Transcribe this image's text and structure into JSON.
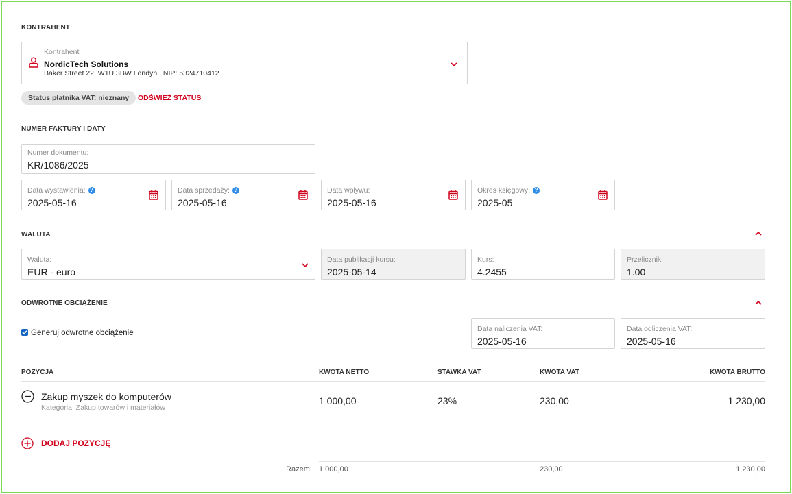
{
  "sections": {
    "contractor": "KONTRAHENT",
    "invoice_dates": "NUMER FAKTURY I DATY",
    "currency": "WALUTA",
    "reverse_charge": "ODWROTNE OBCIĄŻENIE"
  },
  "contractor": {
    "label": "Kontrahent",
    "name": "NordicTech Solutions",
    "address": "Baker Street 22, W1U 3BW Londyn . NIP: 5324710412",
    "vat_status": "Status płatnika VAT: nieznany",
    "refresh_status": "ODŚWIEŻ STATUS"
  },
  "document": {
    "number_label": "Numer dokumentu:",
    "number_value": "KR/1086/2025",
    "issue_label": "Data wystawienia:",
    "issue_value": "2025-05-16",
    "sale_label": "Data sprzedaży:",
    "sale_value": "2025-05-16",
    "receipt_label": "Data wpływu:",
    "receipt_value": "2025-05-16",
    "period_label": "Okres księgowy:",
    "period_value": "2025-05"
  },
  "currency": {
    "currency_label": "Waluta:",
    "currency_value": "EUR - euro",
    "pub_label": "Data publikacji kursu:",
    "pub_value": "2025-05-14",
    "rate_label": "Kurs:",
    "rate_value": "4.2455",
    "multiplier_label": "Przelicznik:",
    "multiplier_value": "1.00"
  },
  "reverse_charge": {
    "checkbox_label": "Generuj odwrotne obciążenie",
    "checked": true,
    "vat_charge_label": "Data naliczenia VAT:",
    "vat_charge_value": "2025-05-16",
    "vat_deduct_label": "Data odliczenia VAT:",
    "vat_deduct_value": "2025-05-16"
  },
  "table": {
    "headers": {
      "position": "POZYCJA",
      "net": "KWOTA NETTO",
      "rate": "STAWKA VAT",
      "vat": "KWOTA VAT",
      "gross": "KWOTA BRUTTO"
    },
    "rows": [
      {
        "name": "Zakup myszek do komputerów",
        "category": "Kategoria: Zakup towarów i materiałów",
        "net": "1 000,00",
        "rate": "23%",
        "vat": "230,00",
        "gross": "1 230,00"
      }
    ],
    "add_label": "DODAJ POZYCJĘ",
    "totals": {
      "label": "Razem:",
      "net": "1 000,00",
      "vat": "230,00",
      "gross": "1 230,00"
    }
  },
  "colors": {
    "accent": "#d0021b",
    "help": "#2f8ee8",
    "frame": "#7ed957"
  }
}
